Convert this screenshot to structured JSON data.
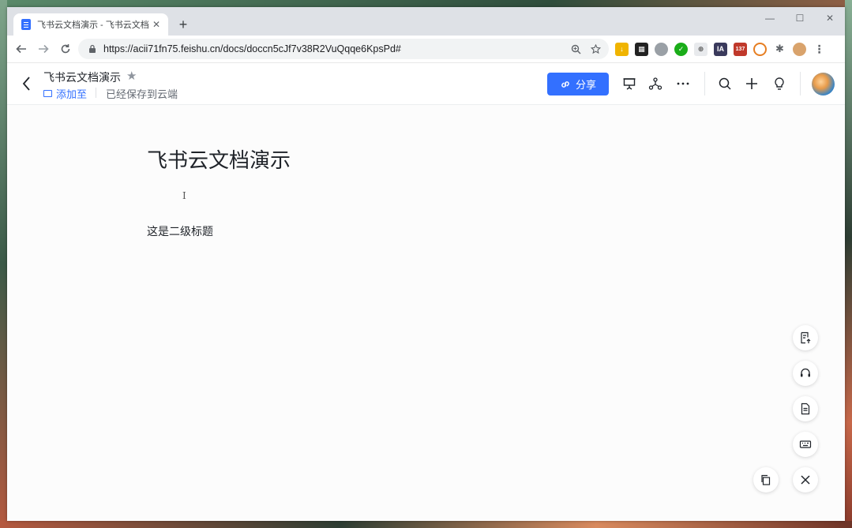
{
  "browser": {
    "tab_title": "飞书云文档演示 - 飞书云文档",
    "new_tab_label": "+",
    "close_tab_label": "✕",
    "url": "https://acii71fn75.feishu.cn/docs/doccn5cJf7v38R2VuQqqe6KpsPd#",
    "window_controls": [
      "—",
      "☐",
      "✕"
    ],
    "extension_badge": "137",
    "extension_ia_label": "IA"
  },
  "doc_header": {
    "title": "飞书云文档演示",
    "add_to_label": "添加至",
    "save_status": "已经保存到云端",
    "share_label": "分享"
  },
  "document": {
    "heading": "飞书云文档演示",
    "subheading": "这是二级标题",
    "cursor_glyph": "I"
  },
  "colors": {
    "accent": "#3370ff",
    "text_primary": "#1f2329",
    "text_secondary": "#646a73"
  }
}
